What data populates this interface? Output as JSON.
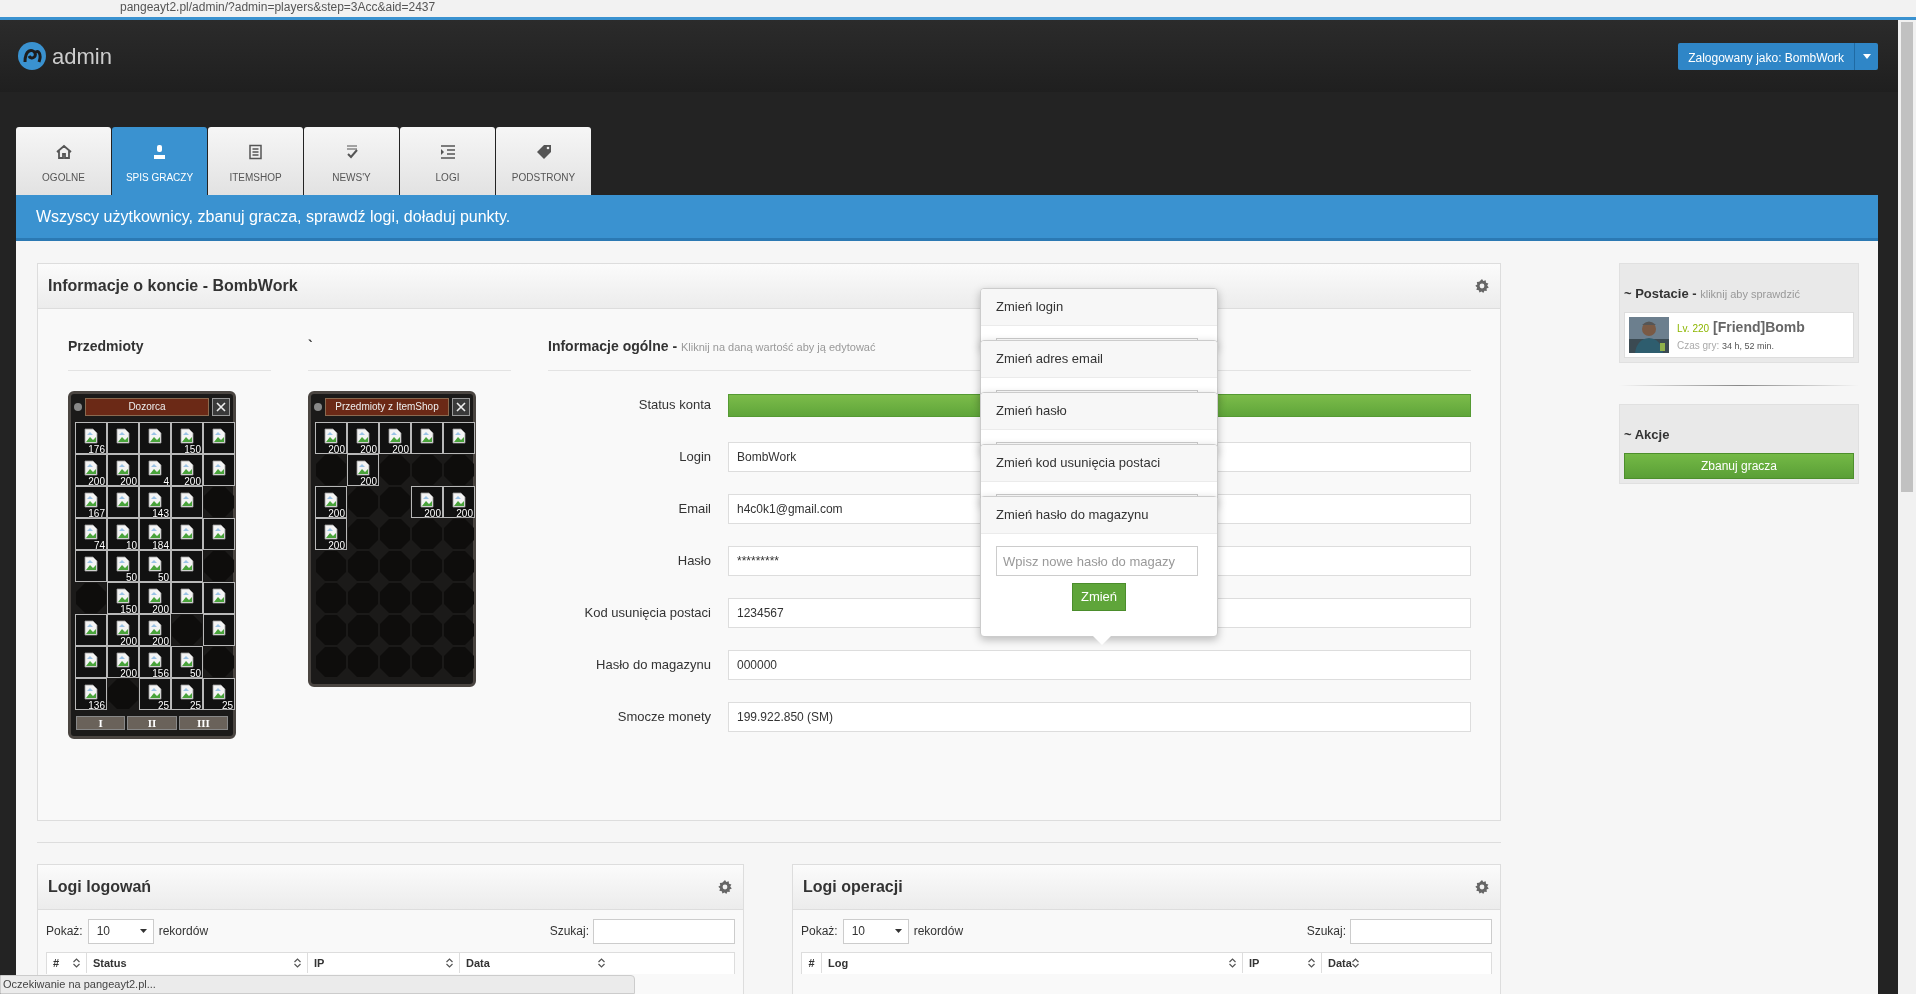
{
  "browser": {
    "url": "pangeayt2.pl/admin/?admin=players&step=3Acc&aid=2437",
    "status": "Oczekiwanie na pangeayt2.pl..."
  },
  "header": {
    "logo_text": "admin",
    "user_button": "Zalogowany jako: BombWork"
  },
  "tabs": [
    {
      "label": "OGOLNE",
      "selected": false
    },
    {
      "label": "SPIS GRACZY",
      "selected": true
    },
    {
      "label": "ITEMSHOP",
      "selected": false
    },
    {
      "label": "NEWS'Y",
      "selected": false
    },
    {
      "label": "LOGI",
      "selected": false
    },
    {
      "label": "PODSTRONY",
      "selected": false
    }
  ],
  "banner": "Wszyscy użytkownicy, zbanuj gracza, sprawdź logi, doładuj punkty.",
  "account_card": {
    "title": "Informacje o koncie - BombWork",
    "items_heading": "Przedmioty",
    "second_heading": "`",
    "inventories": [
      {
        "title": "Dozorca",
        "pages": [
          "I",
          "II",
          "III"
        ],
        "rows": [
          [
            {
              "filled": true,
              "count": "176"
            },
            {
              "filled": true
            },
            {
              "filled": true
            },
            {
              "filled": true,
              "count": "150"
            },
            {
              "filled": true
            }
          ],
          [
            {
              "filled": true,
              "count": "200"
            },
            {
              "filled": true,
              "count": "200"
            },
            {
              "filled": true,
              "count": "4"
            },
            {
              "filled": true,
              "count": "200"
            },
            {
              "filled": true
            }
          ],
          [
            {
              "filled": true,
              "count": "167"
            },
            {
              "filled": true
            },
            {
              "filled": true,
              "count": "143"
            },
            {
              "filled": true
            },
            {
              "filled": false
            }
          ],
          [
            {
              "filled": true,
              "count": "74"
            },
            {
              "filled": true,
              "count": "10"
            },
            {
              "filled": true,
              "count": "184"
            },
            {
              "filled": true
            },
            {
              "filled": true
            }
          ],
          [
            {
              "filled": true
            },
            {
              "filled": true,
              "count": "50"
            },
            {
              "filled": true,
              "count": "50"
            },
            {
              "filled": true
            },
            {
              "filled": false
            }
          ],
          [
            {
              "filled": false
            },
            {
              "filled": true,
              "count": "150"
            },
            {
              "filled": true,
              "count": "200"
            },
            {
              "filled": true
            },
            {
              "filled": true
            }
          ],
          [
            {
              "filled": true
            },
            {
              "filled": true,
              "count": "200"
            },
            {
              "filled": true,
              "count": "200"
            },
            {
              "filled": false
            },
            {
              "filled": true
            }
          ],
          [
            {
              "filled": true
            },
            {
              "filled": true,
              "count": "200"
            },
            {
              "filled": true,
              "count": "156"
            },
            {
              "filled": true,
              "count": "50"
            },
            {
              "filled": false
            }
          ],
          [
            {
              "filled": true,
              "count": "136"
            },
            {
              "filled": false
            },
            {
              "filled": true,
              "count": "25"
            },
            {
              "filled": true,
              "count": "25"
            },
            {
              "filled": true,
              "count": "25"
            }
          ]
        ]
      },
      {
        "title": "Przedmioty z ItemShop",
        "rows": [
          [
            {
              "filled": true,
              "count": "200"
            },
            {
              "filled": true,
              "count": "200"
            },
            {
              "filled": true,
              "count": "200"
            },
            {
              "filled": true
            },
            {
              "filled": true
            }
          ],
          [
            {
              "filled": false
            },
            {
              "filled": true,
              "count": "200"
            },
            {
              "filled": false
            },
            {
              "filled": false
            },
            {
              "filled": false
            }
          ],
          [
            {
              "filled": true,
              "count": "200"
            },
            {
              "filled": false
            },
            {
              "filled": false
            },
            {
              "filled": true,
              "count": "200"
            },
            {
              "filled": true,
              "count": "200"
            }
          ],
          [
            {
              "filled": true,
              "count": "200"
            },
            {
              "filled": false
            },
            {
              "filled": false
            },
            {
              "filled": false
            },
            {
              "filled": false
            }
          ],
          [
            {
              "filled": false
            },
            {
              "filled": false
            },
            {
              "filled": false
            },
            {
              "filled": false
            },
            {
              "filled": false
            }
          ],
          [
            {
              "filled": false
            },
            {
              "filled": false
            },
            {
              "filled": false
            },
            {
              "filled": false
            },
            {
              "filled": false
            }
          ],
          [
            {
              "filled": false
            },
            {
              "filled": false
            },
            {
              "filled": false
            },
            {
              "filled": false
            },
            {
              "filled": false
            }
          ],
          [
            {
              "filled": false
            },
            {
              "filled": false
            },
            {
              "filled": false
            },
            {
              "filled": false
            },
            {
              "filled": false
            }
          ]
        ]
      }
    ],
    "info_heading": "Informacje ogólne -",
    "info_hint": "Kliknij na daną wartość aby ją edytować",
    "fields": [
      {
        "label": "Status konta",
        "kind": "status",
        "active": true
      },
      {
        "label": "Login",
        "kind": "text",
        "value": "BombWork"
      },
      {
        "label": "Email",
        "kind": "text",
        "value": "h4c0k1@gmail.com"
      },
      {
        "label": "Hasło",
        "kind": "text",
        "value": "*********"
      },
      {
        "label": "Kod usunięcia postaci",
        "kind": "text",
        "value": "1234567"
      },
      {
        "label": "Hasło do magazynu",
        "kind": "text",
        "value": "000000"
      },
      {
        "label": "Smocze monety",
        "kind": "text",
        "value": "199.922.850 (SM)"
      }
    ]
  },
  "popovers": [
    {
      "title": "Zmień login"
    },
    {
      "title": "Zmień adres email"
    },
    {
      "title": "Zmień hasło"
    },
    {
      "title": "Zmień kod usunięcia postaci"
    },
    {
      "title": "Zmień hasło do magazynu",
      "placeholder": "Wpisz nowe hasło do magazy",
      "button": "Zmień"
    }
  ],
  "sidebar": {
    "characters_title": "~ Postacie -",
    "characters_hint": "kliknij aby sprawdzić",
    "characters": [
      {
        "lv": "Lv. 220",
        "name": "[Friend]Bomb",
        "time_label": "Czas gry:",
        "time": "34 h, 52 min."
      }
    ],
    "actions_title": "~ Akcje",
    "actions": [
      "Zbanuj gracza"
    ]
  },
  "logs": [
    {
      "title": "Logi logowań",
      "show_label": "Pokaż:",
      "page_size": "10",
      "records_label": "rekordów",
      "search_label": "Szukaj:",
      "columns": [
        {
          "label": "#",
          "sortable": true
        },
        {
          "label": "Status",
          "sortable": true
        },
        {
          "label": "IP",
          "sortable": true
        },
        {
          "label": "Data",
          "sortable": true
        }
      ]
    },
    {
      "title": "Logi operacji",
      "show_label": "Pokaż:",
      "page_size": "10",
      "records_label": "rekordów",
      "search_label": "Szukaj:",
      "columns": [
        {
          "label": "#",
          "sortable": false
        },
        {
          "label": "Log",
          "sortable": true
        },
        {
          "label": "IP",
          "sortable": true
        },
        {
          "label": "Data",
          "sortable": true
        }
      ]
    }
  ]
}
